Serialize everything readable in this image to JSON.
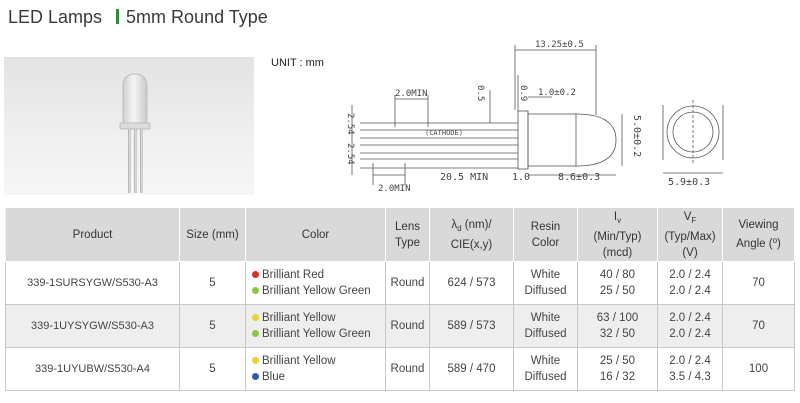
{
  "header": {
    "title_left": "LED Lamps",
    "title_right": "5mm Round Type"
  },
  "unit_label": "UNIT : mm",
  "drawing": {
    "dim_overall_length": "13.25±0.5",
    "dim_2min_top": "2.0MIN",
    "dim_0_5": "0.5",
    "dim_0_9": "0.9",
    "dim_1_0_pm": "1.0±0.2",
    "dim_pitch": "2.54",
    "dim_pitch2": "2.54",
    "cathode_label": "(CATHODE)",
    "dim_20_5": "20.5 MIN",
    "dim_1_0": "1.0",
    "dim_8_6": "8.6±0.3",
    "dim_5_0": "5.0±0.2",
    "dim_5_9": "5.9±0.3",
    "dim_2min_bottom": "2.0MIN"
  },
  "table": {
    "headers": {
      "product": "Product",
      "size": "Size (mm)",
      "color": "Color",
      "lens_a": "Lens",
      "lens_b": "Type",
      "lambda_a_pre": "λ",
      "lambda_a_sub": "d",
      "lambda_a_post": " (nm)/",
      "lambda_b": "CIE(x,y)",
      "resin_a": "Resin",
      "resin_b": "Color",
      "iv_a_pre": "I",
      "iv_a_sub": "v",
      "iv_b": "(Min/Typ)",
      "iv_c": "(mcd)",
      "vf_a_pre": "V",
      "vf_a_sub": "F",
      "vf_b": "(Typ/Max)",
      "vf_c": "(V)",
      "view_a": "Viewing",
      "view_b_pre": "Angle (",
      "view_b_sup": "o",
      "view_b_post": ")"
    },
    "rows": [
      {
        "product": "339-1SURSYGW/S530-A3",
        "size": "5",
        "colors": [
          {
            "name": "Brilliant Red",
            "dot": "#d93025"
          },
          {
            "name": "Brilliant Yellow Green",
            "dot": "#8cc63f"
          }
        ],
        "lens": "Round",
        "lambda": "624 / 573",
        "resin_a": "White",
        "resin_b": "Diffused",
        "iv_a": "40 / 80",
        "iv_b": "25 / 50",
        "vf_a": "2.0 / 2.4",
        "vf_b": "2.0 / 2.4",
        "angle": "70"
      },
      {
        "product": "339-1UYSYGW/S530-A3",
        "size": "5",
        "colors": [
          {
            "name": "Brilliant Yellow",
            "dot": "#e8d23a"
          },
          {
            "name": "Brilliant Yellow Green",
            "dot": "#8cc63f"
          }
        ],
        "lens": "Round",
        "lambda": "589 / 573",
        "resin_a": "White",
        "resin_b": "Diffused",
        "iv_a": "63 / 100",
        "iv_b": "32 / 50",
        "vf_a": "2.0 / 2.4",
        "vf_b": "2.0 / 2.4",
        "angle": "70"
      },
      {
        "product": "339-1UYUBW/S530-A4",
        "size": "5",
        "colors": [
          {
            "name": "Brilliant Yellow",
            "dot": "#e8d23a"
          },
          {
            "name": "Blue",
            "dot": "#2a5db0"
          }
        ],
        "lens": "Round",
        "lambda": "589 / 470",
        "resin_a": "White",
        "resin_b": "Diffused",
        "iv_a": "25 / 50",
        "iv_b": "16 / 32",
        "vf_a": "2.0 / 2.4",
        "vf_b": "3.5 / 4.3",
        "angle": "100"
      }
    ]
  }
}
